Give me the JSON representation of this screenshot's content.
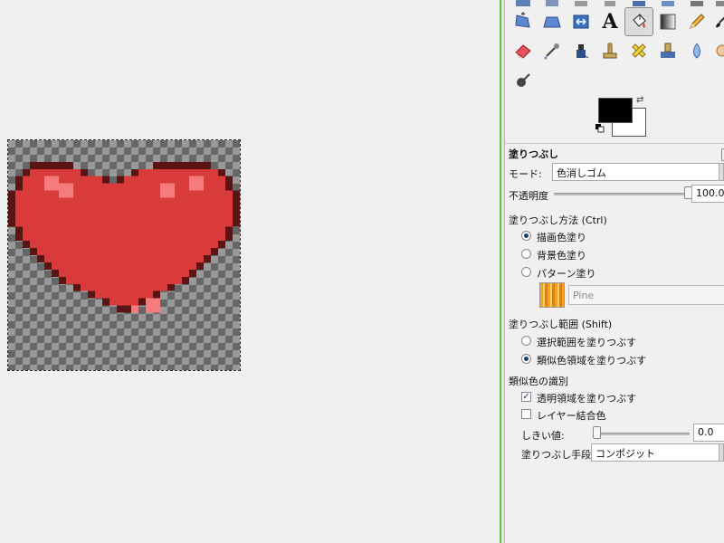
{
  "canvas": {
    "layer": "heart"
  },
  "tools": [
    {
      "name": "perspective-icon"
    },
    {
      "name": "flip-icon"
    },
    {
      "name": "cage-transform-icon"
    },
    {
      "name": "text-icon",
      "glyph": "A"
    },
    {
      "name": "bucket-fill-icon"
    },
    {
      "name": "blend-icon"
    },
    {
      "name": "pencil-icon"
    },
    {
      "name": "paintbrush-icon"
    },
    {
      "name": "eraser-icon"
    },
    {
      "name": "airbrush-icon"
    },
    {
      "name": "ink-icon"
    },
    {
      "name": "clone-icon"
    },
    {
      "name": "heal-icon"
    },
    {
      "name": "perspective-clone-icon"
    },
    {
      "name": "blur-sharpen-icon"
    },
    {
      "name": "smudge-icon"
    },
    {
      "name": "dodge-burn-icon"
    }
  ],
  "colors": {
    "foreground": "#000000",
    "background": "#ffffff"
  },
  "options": {
    "title": "塗りつぶし",
    "mode_label": "モード:",
    "mode_value": "色消しゴム",
    "opacity_label": "不透明度",
    "opacity_value": "100.0",
    "opacity_fraction": 1.0,
    "fill_type_label": "塗りつぶし方法 (Ctrl)",
    "fill_type_options": [
      "描画色塗り",
      "背景色塗り",
      "パターン塗り"
    ],
    "fill_type_selected": 0,
    "pattern_name": "Pine",
    "affected_area_label": "塗りつぶし範囲 (Shift)",
    "affected_area_options": [
      "選択範囲を塗りつぶす",
      "類似色領域を塗りつぶす"
    ],
    "affected_area_selected": 1,
    "similar_colors_label": "類似色の識別",
    "fill_transparent_label": "透明領域を塗りつぶす",
    "fill_transparent_checked": true,
    "sample_merged_label": "レイヤー結合色",
    "sample_merged_checked": false,
    "threshold_label": "しきい値:",
    "threshold_value": "0.0",
    "fill_by_label": "塗りつぶし手段:",
    "fill_by_value": "コンポジット"
  }
}
